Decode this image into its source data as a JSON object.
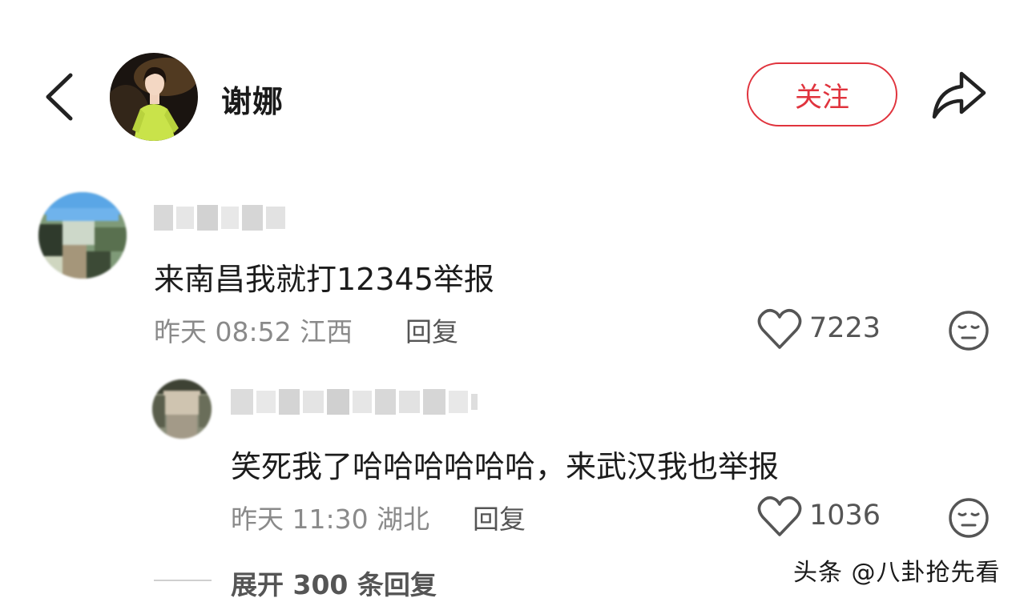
{
  "header": {
    "username": "谢娜",
    "follow_label": "关注",
    "icons": {
      "back": "back-chevron-icon",
      "share": "share-arrow-icon"
    }
  },
  "comments": [
    {
      "text": "来南昌我就打12345举报",
      "meta": "昨天 08:52 江西",
      "reply_label": "回复",
      "likes": "7223"
    },
    {
      "text": "笑死我了哈哈哈哈哈哈，来武汉我也举报",
      "meta": "昨天 11:30 湖北",
      "reply_label": "回复",
      "likes": "1036"
    }
  ],
  "expand_label": "展开 300 条回复",
  "watermark": "头条 @八卦抢先看",
  "colors": {
    "accent": "#e0333d",
    "meta": "#8a8a8a"
  }
}
